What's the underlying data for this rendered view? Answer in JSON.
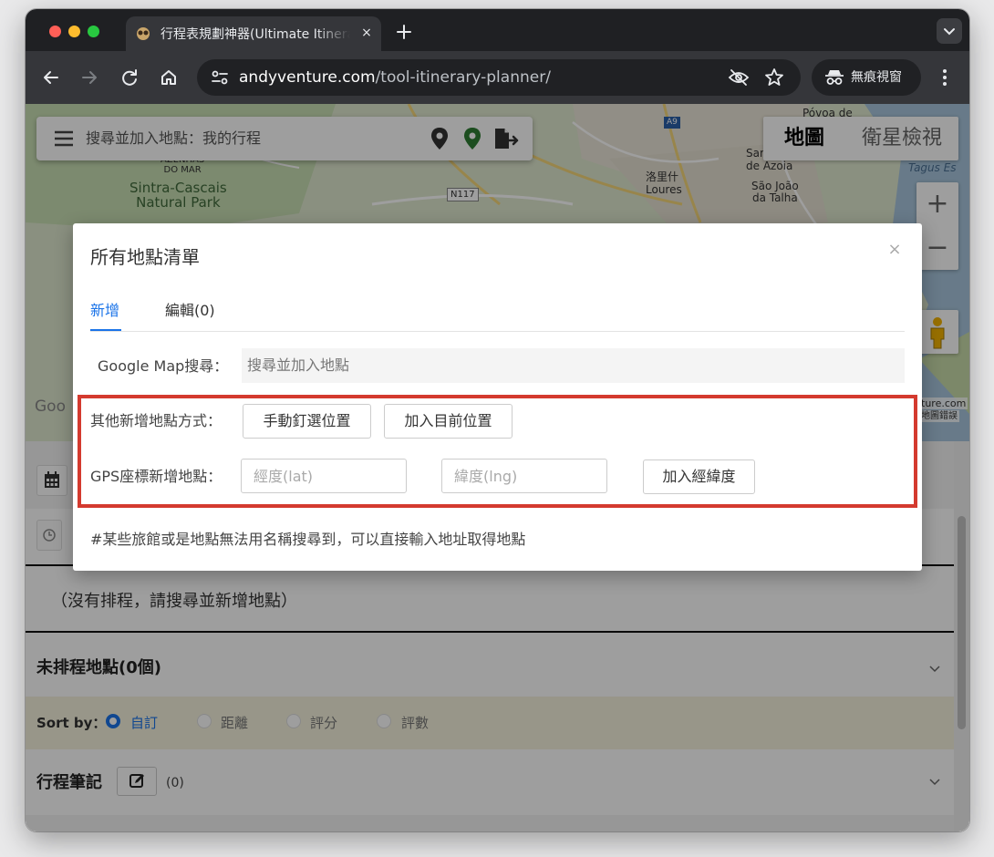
{
  "browser": {
    "tab_title": "行程表規劃神器(Ultimate Itinerary Planner)",
    "tab_close": "×",
    "url_domain": "andyventure.com",
    "url_path": "/tool-itinerary-planner/",
    "incognito_label": "無痕視窗"
  },
  "map": {
    "search_placeholder": "搜尋並加入地點：我的行程",
    "map_type_map": "地圖",
    "map_type_satellite": "衛星檢視",
    "zoom_in": "+",
    "zoom_out": "−",
    "labels": {
      "povoa": "Póvoa de",
      "sar": "Sar",
      "azoia": "de Azoia",
      "tagus": "Tagus Es",
      "azenhas": "AZENHAS\nDO MAR",
      "sintra": "Sintra-Cascais\nNatural Park",
      "loures_cn": "洛里什",
      "loures": "Loures",
      "sao_joao": "São João\nda Talha",
      "n117": "N117",
      "a9": "A9",
      "google": "Goo",
      "terms": "ture.com",
      "terms2": "地圖錯誤"
    }
  },
  "schedule": {
    "empty_text": "（沒有排程，請搜尋並新增地點）",
    "unscheduled_title": "未排程地點(0個)",
    "sort_label": "Sort by：",
    "sort_options": [
      "自訂",
      "距離",
      "評分",
      "評數"
    ],
    "notes_title": "行程筆記",
    "notes_count": "(0)"
  },
  "modal": {
    "title": "所有地點清單",
    "close": "×",
    "tabs": [
      "新增",
      "編輯(0)"
    ],
    "google_search_label": "Google Map搜尋：",
    "google_search_placeholder": "搜尋並加入地點",
    "other_methods_label": "其他新增地點方式：",
    "manual_pin_button": "手動釘選位置",
    "current_location_button": "加入目前位置",
    "gps_label": "GPS座標新增地點：",
    "lat_placeholder": "經度(lat)",
    "lng_placeholder": "緯度(lng)",
    "add_coords_button": "加入經緯度",
    "note": "#某些旅館或是地點無法用名稱搜尋到，可以直接輸入地址取得地點"
  },
  "colors": {
    "accent": "#1a73e8",
    "highlight_box": "#d43a2f"
  }
}
